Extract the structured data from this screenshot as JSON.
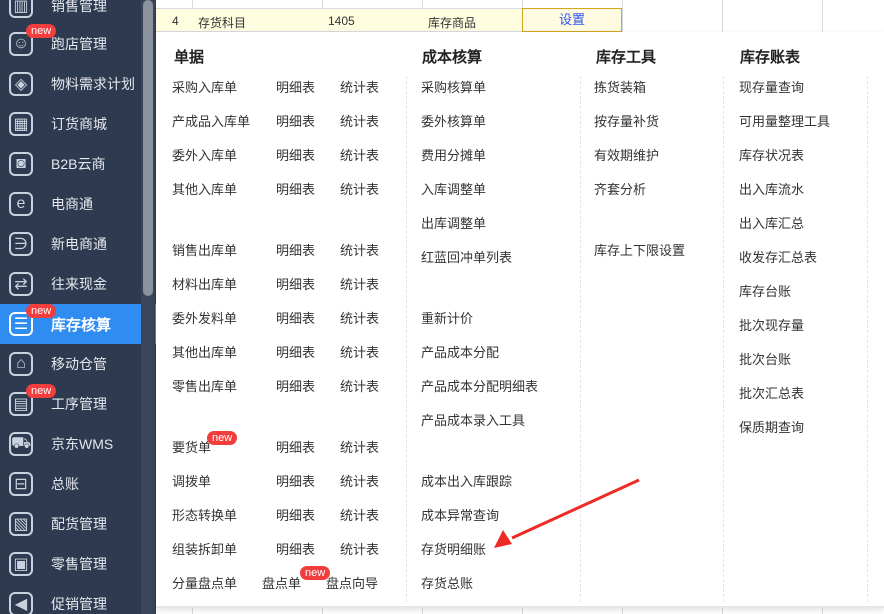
{
  "sidebar": {
    "items": [
      {
        "label": "销售管理",
        "icon": "bar-chart-icon",
        "glyph": "▥",
        "new": false
      },
      {
        "label": "跑店管理",
        "icon": "contact-card-icon",
        "glyph": "☺",
        "new": true
      },
      {
        "label": "物料需求计划",
        "icon": "cube-icon",
        "glyph": "◈",
        "new": false
      },
      {
        "label": "订货商城",
        "icon": "storefront-icon",
        "glyph": "▦",
        "new": false
      },
      {
        "label": "B2B云商",
        "icon": "shopping-bag-icon",
        "glyph": "◙",
        "new": false
      },
      {
        "label": "电商通",
        "icon": "ecommerce-e-icon",
        "glyph": "e",
        "new": false
      },
      {
        "label": "新电商通",
        "icon": "new-ecommerce-icon",
        "glyph": "∋",
        "new": false
      },
      {
        "label": "往来现金",
        "icon": "exchange-arrows-icon",
        "glyph": "⇄",
        "new": false
      },
      {
        "label": "库存核算",
        "icon": "warehouse-shelf-icon",
        "glyph": "☰",
        "new": true,
        "active": true
      },
      {
        "label": "移动仓管",
        "icon": "mobile-warehouse-icon",
        "glyph": "⌂",
        "new": false
      },
      {
        "label": "工序管理",
        "icon": "process-doc-icon",
        "glyph": "▤",
        "new": true
      },
      {
        "label": "京东WMS",
        "icon": "truck-icon",
        "glyph": "⛟",
        "new": false
      },
      {
        "label": "总账",
        "icon": "ledger-tray-icon",
        "glyph": "⊟",
        "new": false
      },
      {
        "label": "配货管理",
        "icon": "distribution-doc-icon",
        "glyph": "▧",
        "new": false
      },
      {
        "label": "零售管理",
        "icon": "retail-store-icon",
        "glyph": "▣",
        "new": false
      },
      {
        "label": "促销管理",
        "icon": "megaphone-icon",
        "glyph": "◀",
        "new": false
      }
    ],
    "new_badge": "new"
  },
  "grid_row": {
    "index": "4",
    "subject": "存货科目",
    "code": "1405",
    "goods": "库存商品",
    "action": "设置"
  },
  "menu": {
    "columns": [
      {
        "title": "单据"
      },
      {
        "title": "成本核算"
      },
      {
        "title": "库存工具"
      },
      {
        "title": "库存账表"
      }
    ],
    "docs": [
      [
        "采购入库单",
        "明细表",
        "统计表"
      ],
      [
        "产成品入库单",
        "明细表",
        "统计表"
      ],
      [
        "委外入库单",
        "明细表",
        "统计表"
      ],
      [
        "其他入库单",
        "明细表",
        "统计表"
      ],
      [
        "销售出库单",
        "明细表",
        "统计表"
      ],
      [
        "材料出库单",
        "明细表",
        "统计表"
      ],
      [
        "委外发料单",
        "明细表",
        "统计表"
      ],
      [
        "其他出库单",
        "明细表",
        "统计表"
      ],
      [
        "零售出库单",
        "明细表",
        "统计表"
      ],
      [
        "要货单",
        "明细表",
        "统计表"
      ],
      [
        "调拨单",
        "明细表",
        "统计表"
      ],
      [
        "形态转换单",
        "明细表",
        "统计表"
      ],
      [
        "组装拆卸单",
        "明细表",
        "统计表"
      ]
    ],
    "last_row": [
      "分量盘点单",
      "盘点单",
      "盘点向导"
    ],
    "cost": [
      "采购核算单",
      "委外核算单",
      "费用分摊单",
      "入库调整单",
      "出库调整单",
      "红蓝回冲单列表",
      "重新计价",
      "产品成本分配",
      "产品成本分配明细表",
      "产品成本录入工具",
      "成本出入库跟踪",
      "成本异常查询",
      "存货明细账",
      "存货总账"
    ],
    "tools": [
      "拣货装箱",
      "按存量补货",
      "有效期维护",
      "齐套分析",
      "库存上下限设置"
    ],
    "reports": [
      "现存量查询",
      "可用量整理工具",
      "库存状况表",
      "出入库流水",
      "出入库汇总",
      "收发存汇总表",
      "库存台账",
      "批次现存量",
      "批次台账",
      "批次汇总表",
      "保质期查询"
    ]
  },
  "colors": {
    "sidebar_bg": "#2e3a4f",
    "active_bg": "#2f8cf0",
    "badge": "#f23d3d",
    "arrow": "#ee2a24"
  }
}
